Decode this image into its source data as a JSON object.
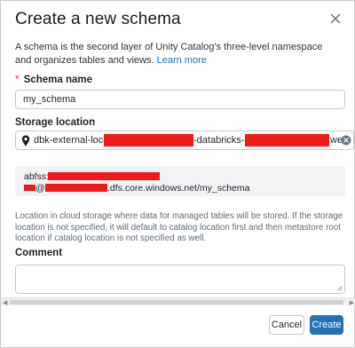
{
  "dialog": {
    "title": "Create a new schema",
    "description": "A schema is the second layer of Unity Catalog's three-level namespace and organizes tables and views.",
    "learn_more": "Learn more"
  },
  "schema_name": {
    "required_mark": "*",
    "label": "Schema name",
    "value": "my_schema"
  },
  "storage_location": {
    "label": "Storage location",
    "segment1": "dbk-external-location",
    "segment2": "-databricks-c",
    "segment3": "weu"
  },
  "path": {
    "line1_prefix": "abfss://",
    "line2_at": "@",
    "line2_suffix": ".dfs.core.windows.net/my_schema"
  },
  "hint": "Location in cloud storage where data for managed tables will be stored. If the storage location is not specified, it will default to catalog location first and then metastore root location if catalog location is not specified as well.",
  "comment": {
    "label": "Comment",
    "value": ""
  },
  "buttons": {
    "cancel": "Cancel",
    "create": "Create"
  },
  "colors": {
    "primary": "#2272b4",
    "redaction": "#ee1a1a",
    "required": "#dd3333"
  },
  "icons": {
    "close": "close-icon",
    "location": "location-pin-icon",
    "clear": "clear-icon",
    "resize": "resize-handle-icon"
  }
}
